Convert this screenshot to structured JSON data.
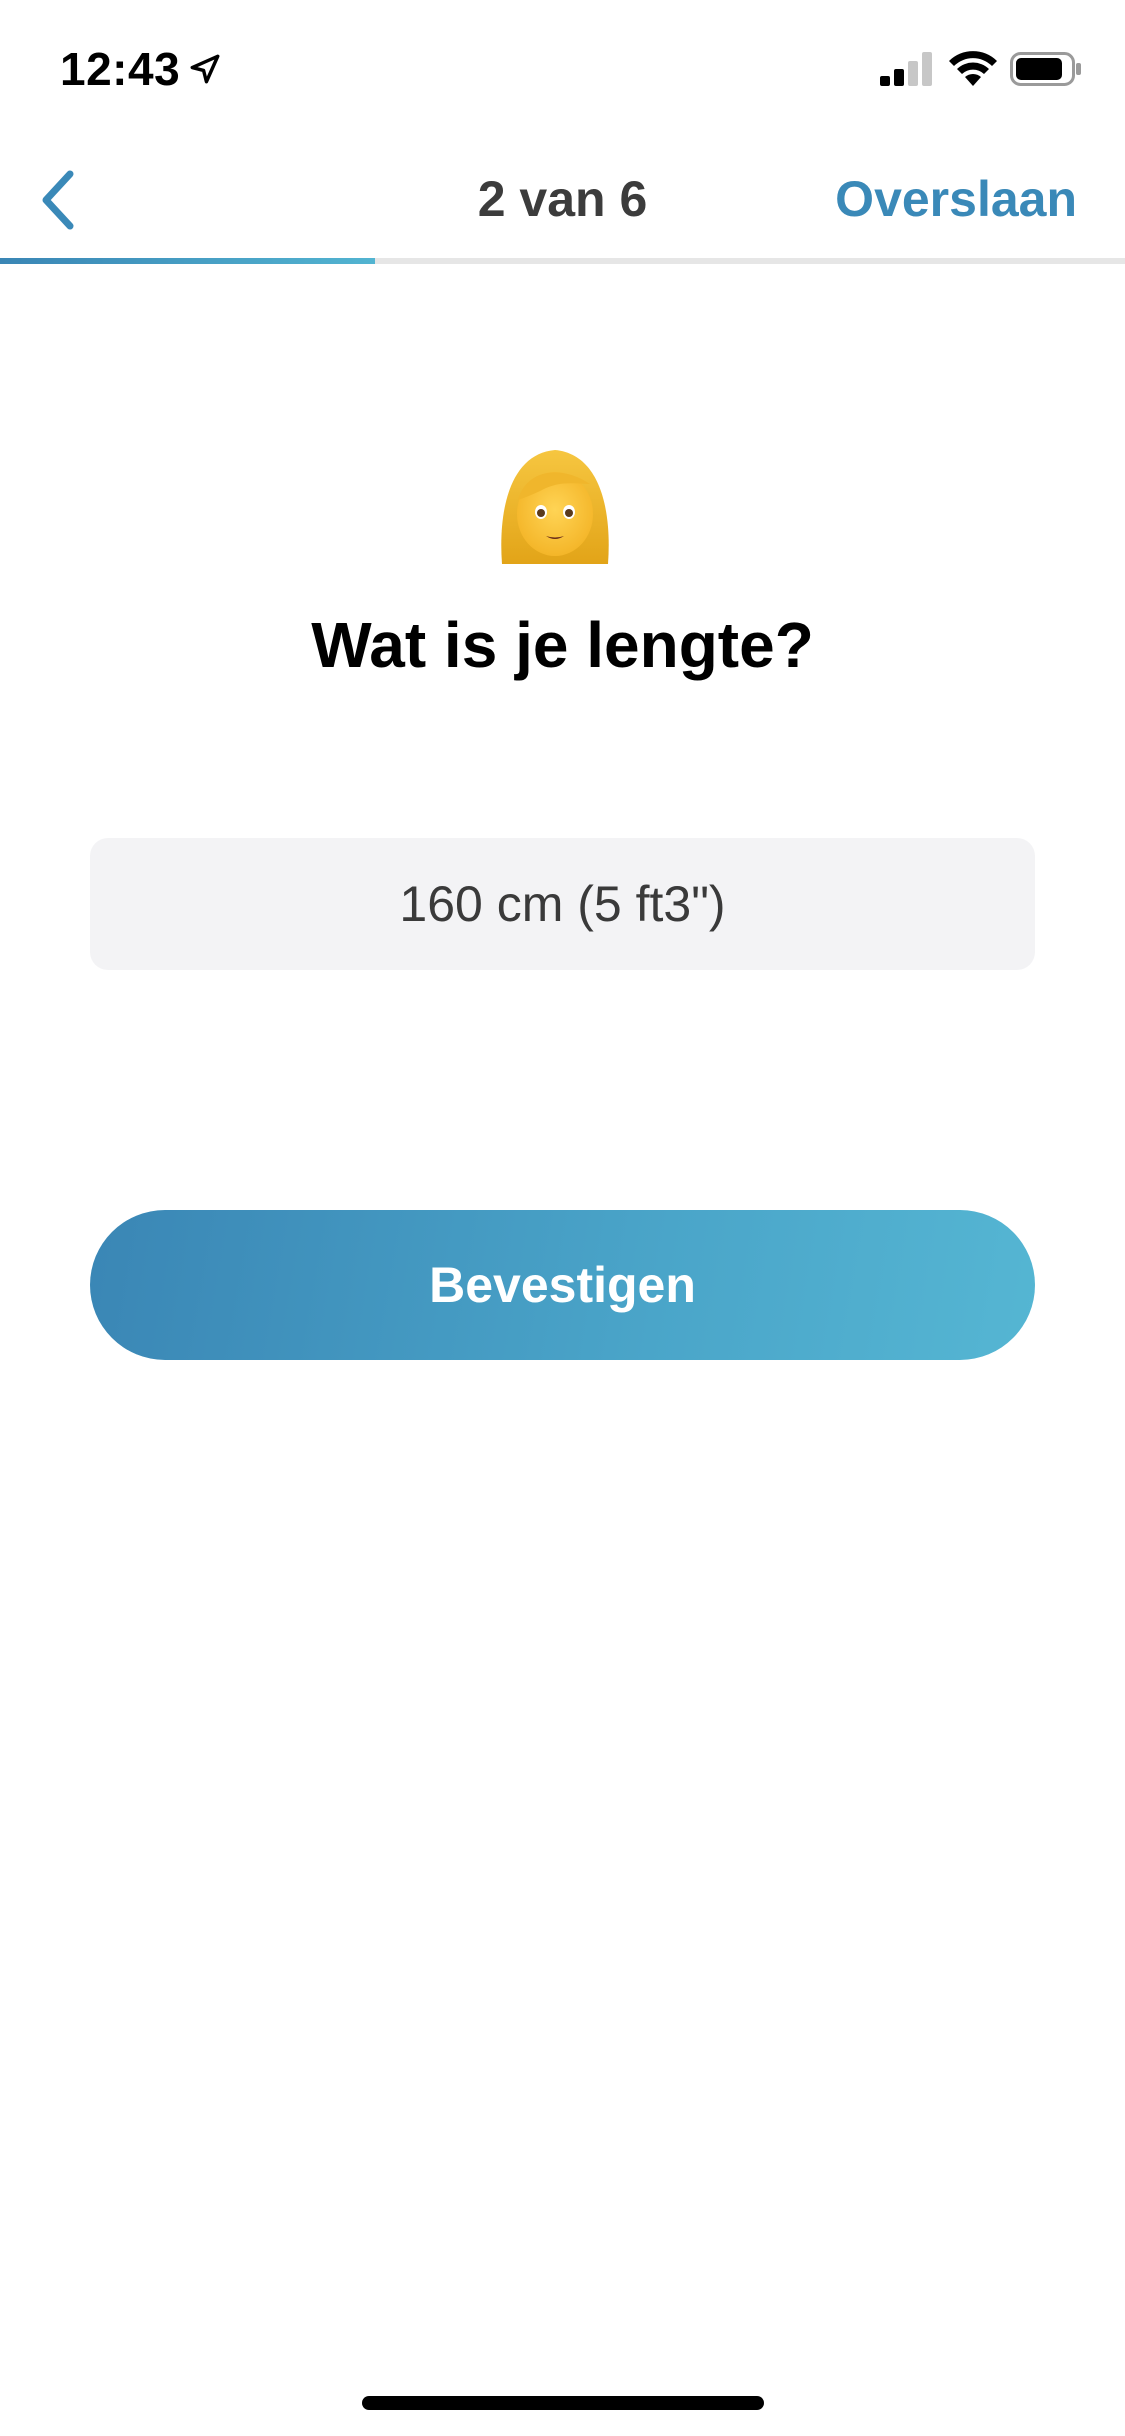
{
  "status_bar": {
    "time": "12:43",
    "icons": [
      "location-arrow-icon",
      "signal-icon",
      "wifi-icon",
      "battery-icon"
    ]
  },
  "nav": {
    "back_icon": "chevron-left-icon",
    "step": "2 van 6",
    "skip_label": "Overslaan"
  },
  "progress": {
    "value": 0.333
  },
  "content": {
    "emoji": "woman-emoji",
    "title": "Wat is je lengte?",
    "height_value": "160 cm (5 ft3\")",
    "confirm_label": "Bevestigen"
  },
  "colors": {
    "accent": "#3a89b8",
    "accent_light": "#55b6d3",
    "field_bg": "#f3f3f5",
    "text_dark": "#000000",
    "text_gray": "#3c3c3c"
  }
}
